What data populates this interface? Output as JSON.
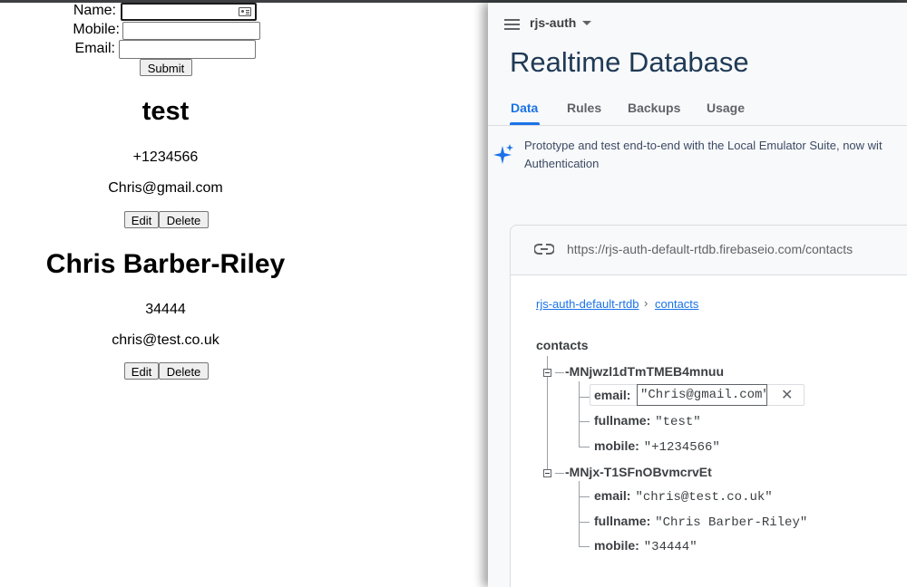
{
  "form": {
    "name_label": "Name:",
    "mobile_label": "Mobile:",
    "email_label": "Email:",
    "name_value": "",
    "mobile_value": "",
    "email_value": "",
    "submit_label": "Submit"
  },
  "contacts": [
    {
      "name": "test",
      "mobile": "+1234566",
      "email": "Chris@gmail.com",
      "edit_label": "Edit",
      "delete_label": "Delete"
    },
    {
      "name": "Chris Barber-Riley",
      "mobile": "34444",
      "email": "chris@test.co.uk",
      "edit_label": "Edit",
      "delete_label": "Delete"
    }
  ],
  "firebase": {
    "project": "rjs-auth",
    "title": "Realtime Database",
    "tabs": [
      "Data",
      "Rules",
      "Backups",
      "Usage"
    ],
    "active_tab": "Data",
    "banner_line1": "Prototype and test end-to-end with the Local Emulator Suite, now wit",
    "banner_line2": "Authentication",
    "url": "https://rjs-auth-default-rtdb.firebaseio.com/contacts",
    "breadcrumb": [
      "rjs-auth-default-rtdb",
      "contacts"
    ],
    "breadcrumb_sep": "›",
    "root": "contacts",
    "nodes": [
      {
        "key": "-MNjwzl1dTmTMEB4mnuu",
        "fields": [
          {
            "key": "email:",
            "value": "\"Chris@gmail.com\""
          },
          {
            "key": "fullname:",
            "value": "\"test\""
          },
          {
            "key": "mobile:",
            "value": "\"+1234566\""
          }
        ]
      },
      {
        "key": "-MNjx-T1SFnOBvmcrvEt",
        "fields": [
          {
            "key": "email:",
            "value": "\"chris@test.co.uk\""
          },
          {
            "key": "fullname:",
            "value": "\"Chris Barber-Riley\""
          },
          {
            "key": "mobile:",
            "value": "\"34444\""
          }
        ]
      }
    ],
    "cancel_glyph": "✕",
    "icons": [
      "menu-icon",
      "dropdown-caret-icon",
      "sparkle-icon",
      "link-icon",
      "collapse-icon",
      "close-icon"
    ],
    "accent_color": "#1a73e8"
  }
}
